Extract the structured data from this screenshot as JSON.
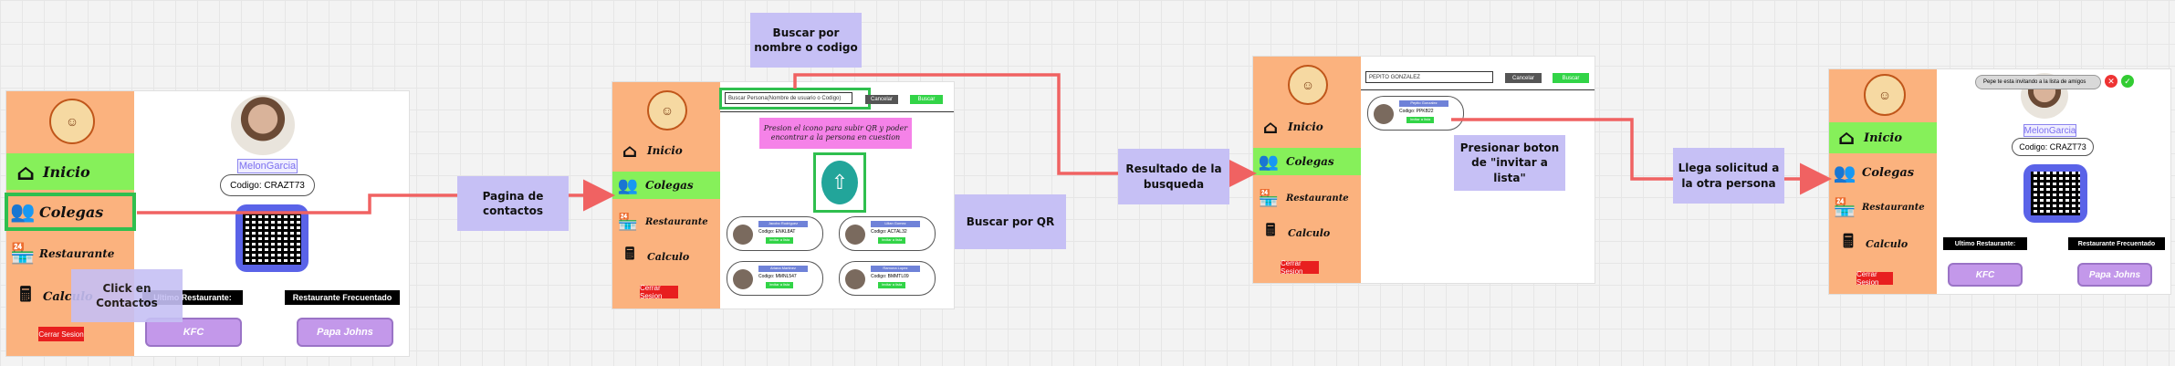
{
  "nav": {
    "inicio": "Inicio",
    "colegas": "Colegas",
    "restaurante": "Restaurante",
    "calculo": "Calculo",
    "logout": "Cerrar Sesion"
  },
  "profile": {
    "username": "MelonGarcia",
    "code": "Codigo: CRAZT73",
    "last_restaurant_label": "Ultimo Restaurante:",
    "frequent_restaurant_label": "Restaurante Frecuentado",
    "last_restaurant": "KFC",
    "frequent_restaurant": "Papa Johns"
  },
  "contacts_screen": {
    "search_placeholder": "Buscar Persona(Nombre de usuario o Codigo)",
    "cancel_label": "Cancelar",
    "search_label": "Buscar",
    "qr_note": "Presion el icono para subir QR y poder encontrar a la persona en cuestion",
    "cards": [
      {
        "name": "Jacobo Rodriguez",
        "code": "Codigo: ENKL8AT",
        "action": "Invitar a lista"
      },
      {
        "name": "Lilian Gomez",
        "code": "Codigo: ACTAL32",
        "action": "Invitar a lista"
      },
      {
        "name": "Ariana Martinez",
        "code": "Codigo: MMNL547",
        "action": "Invitar a lista"
      },
      {
        "name": "Ramona Lopez",
        "code": "Codigo: BMMTL09",
        "action": "Invitar a lista"
      }
    ]
  },
  "result_screen": {
    "search_value": "PEPITO GONZALEZ",
    "cancel_label": "Cancelar",
    "search_label": "Buscar",
    "card": {
      "name": "Pepito Gonzalez",
      "code": "Codigo: PPKB22",
      "action": "Invitar a lista"
    }
  },
  "final_screen": {
    "notification": "Pepe te esta invitando a la lista de amigos"
  },
  "notes": {
    "click_contactos": "Click en Contactos",
    "pagina_contactos": "Pagina de contactos",
    "buscar_nombre": "Buscar por nombre o codigo",
    "buscar_qr": "Buscar por QR",
    "resultado": "Resultado de la busqueda",
    "presionar": "Presionar boton de \"invitar a lista\"",
    "llega": "Llega solicitud a la otra persona"
  },
  "colors": {
    "arrow": "#f06262",
    "highlight": "#2fbf4e",
    "sidebar": "#fbb27e",
    "active": "#86f05a",
    "sticky": "#c6c0f5"
  }
}
